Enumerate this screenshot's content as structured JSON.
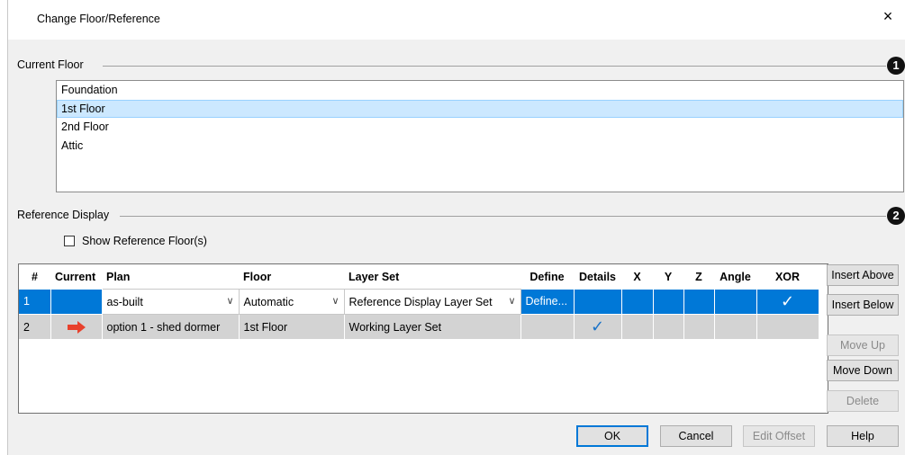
{
  "dialog": {
    "title": "Change Floor/Reference",
    "close_glyph": "×"
  },
  "current_floor": {
    "group_label": "Current Floor",
    "callout": "1",
    "floors": [
      {
        "label": "Foundation",
        "selected": false
      },
      {
        "label": "1st Floor",
        "selected": true
      },
      {
        "label": "2nd Floor",
        "selected": false
      },
      {
        "label": "Attic",
        "selected": false
      }
    ]
  },
  "reference_display": {
    "group_label": "Reference Display",
    "callout": "2",
    "show_reference_label": "Show Reference Floor(s)",
    "show_reference_checked": false,
    "columns": [
      "#",
      "Current",
      "Plan",
      "Floor",
      "Layer Set",
      "Define",
      "Details",
      "X",
      "Y",
      "Z",
      "Angle",
      "XOR"
    ],
    "rows": [
      {
        "num": "1",
        "current": "",
        "plan": "as-built",
        "floor": "Automatic",
        "layer_set": "Reference Display Layer Set",
        "define": "Define...",
        "details": false,
        "xor": true,
        "selected": true
      },
      {
        "num": "2",
        "current": "arrow",
        "plan": "option 1 - shed dormer",
        "floor": "1st Floor",
        "layer_set": "Working Layer Set",
        "define": "",
        "details": true,
        "xor": false,
        "selected": false
      }
    ],
    "colors": {
      "selection": "#0078d7",
      "row_bg": "#d3d3d3",
      "arrow": "#e8412c",
      "check": "#1a73c8"
    }
  },
  "side_buttons": {
    "insert_above": "Insert Above",
    "insert_below": "Insert Below",
    "move_up": "Move Up",
    "move_down": "Move Down",
    "delete": "Delete"
  },
  "footer": {
    "ok": "OK",
    "cancel": "Cancel",
    "edit_offset": "Edit Offset",
    "help": "Help"
  }
}
